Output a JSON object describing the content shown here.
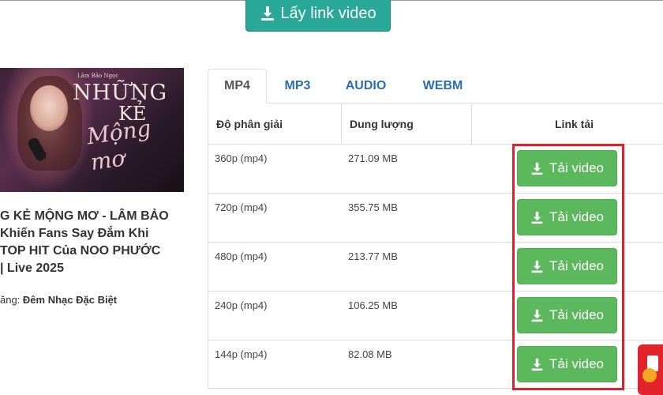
{
  "get_link_button": {
    "label": "Lấy link video",
    "icon": "download-icon"
  },
  "video": {
    "thumbnail": {
      "small_caption": "Lâm Bảo Ngọc",
      "title_line1": "NHỮNG",
      "title_line2": "KẺ",
      "title_line3": "Mộng mơ"
    },
    "title_lines": [
      "G KẺ MỘNG MƠ - LÂM BẢO",
      " Khiến Fans Say Đắm Khi",
      " TOP HIT Của NOO PHƯỚC",
      " | Live 2025"
    ],
    "channel_prefix": "ăng: ",
    "channel_name": "Đêm Nhạc Đặc Biệt"
  },
  "tabs": [
    {
      "label": "MP4",
      "active": true
    },
    {
      "label": "MP3",
      "active": false
    },
    {
      "label": "AUDIO",
      "active": false
    },
    {
      "label": "WEBM",
      "active": false
    }
  ],
  "table": {
    "headers": [
      "Độ phân giải",
      "Dung lượng",
      "Link tải"
    ],
    "rows": [
      {
        "resolution": "360p (mp4)",
        "size": "271.09 MB",
        "button": "Tải video"
      },
      {
        "resolution": "720p (mp4)",
        "size": "355.75 MB",
        "button": "Tải video"
      },
      {
        "resolution": "480p (mp4)",
        "size": "213.77 MB",
        "button": "Tải video"
      },
      {
        "resolution": "240p (mp4)",
        "size": "106.25 MB",
        "button": "Tải video"
      },
      {
        "resolution": "144p (mp4)",
        "size": "82.08 MB",
        "button": "Tải video"
      }
    ]
  },
  "colors": {
    "teal": "#2aa897",
    "green": "#5cb85c",
    "tab_link": "#2a6eb0",
    "highlight": "#e0202a"
  }
}
